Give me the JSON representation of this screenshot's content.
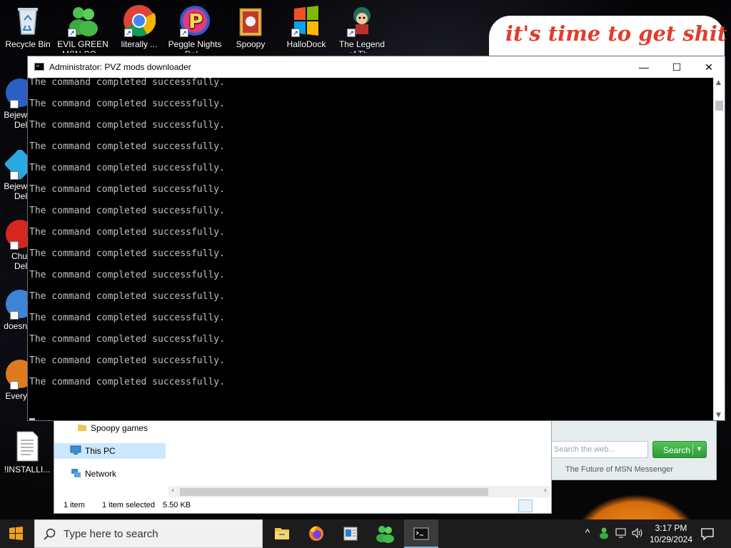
{
  "desktop": {
    "icons": [
      {
        "label": "Recycle Bin",
        "icon": "recycle-bin-icon"
      },
      {
        "label": "EVIL GREEN MSN CO...",
        "icon": "msn-buddy-icon"
      },
      {
        "label": "literally ...",
        "icon": "chrome-icon"
      },
      {
        "label": "Peggle Nights Del...",
        "icon": "peggle-icon"
      },
      {
        "label": "Spoopy",
        "icon": "folder-icon"
      },
      {
        "label": "HalloDock",
        "icon": "windows-logo-icon"
      },
      {
        "label": "The Legend of Th...",
        "icon": "character-icon"
      }
    ],
    "left_icons": [
      {
        "label1": "Bejew",
        "label2": "Del",
        "icon": "bejeweled-icon"
      },
      {
        "label1": "Bejew",
        "label2": "Del",
        "icon": "bejeweled-gem-icon"
      },
      {
        "label1": "Chu",
        "label2": "Del",
        "icon": "chuzzle-icon"
      },
      {
        "label1": "doesn",
        "label2": "",
        "icon": "app-icon"
      },
      {
        "label1": "Every",
        "label2": "",
        "icon": "app-icon"
      }
    ],
    "installing_file": {
      "label": "!INSTALLI...",
      "icon": "text-file-icon"
    },
    "banner_text": "it's time to get shit"
  },
  "console": {
    "title": "Administrator:  PVZ mods downloader",
    "lines": [
      "The command completed successfully.",
      "The command completed successfully.",
      "The command completed successfully.",
      "The command completed successfully.",
      "The command completed successfully.",
      "The command completed successfully.",
      "The command completed successfully.",
      "The command completed successfully.",
      "The command completed successfully.",
      "The command completed successfully.",
      "The command completed successfully.",
      "The command completed successfully.",
      "The command completed successfully.",
      "The command completed successfully.",
      "The command completed successfully."
    ],
    "buttons": {
      "minimize": "—",
      "maximize": "☐",
      "close": "✕"
    }
  },
  "explorer": {
    "nav": [
      {
        "label": "Spoopy games",
        "icon": "folder-icon",
        "selected": false
      },
      {
        "label": "This PC",
        "icon": "computer-icon",
        "selected": true
      },
      {
        "label": "Network",
        "icon": "network-icon",
        "selected": false
      }
    ],
    "status": {
      "count": "1 item",
      "selected": "1 item selected",
      "size": "5.50 KB"
    }
  },
  "msn": {
    "search_placeholder": "Search the web...",
    "search_button": "Search",
    "footer": "The Future of MSN Messenger"
  },
  "taskbar": {
    "search_placeholder": "Type here to search",
    "apps": [
      "file-explorer-icon",
      "firefox-icon",
      "notepad-app-icon",
      "msn-buddy-icon",
      "command-prompt-icon"
    ],
    "time": "3:17 PM",
    "date": "10/29/2024"
  },
  "colors": {
    "console_text": "#c0c0c0",
    "taskbar": "#1c1c1c",
    "accent": "#76b9ed",
    "msn_green": "#3aa942"
  }
}
